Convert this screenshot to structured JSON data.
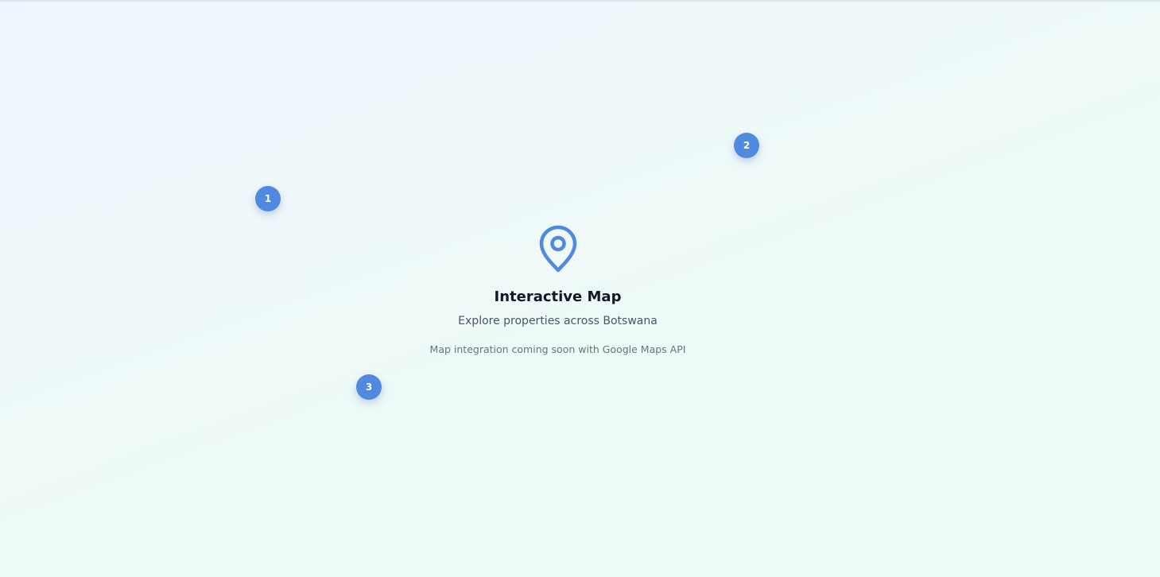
{
  "map": {
    "title": "Interactive Map",
    "subtitle": "Explore properties across Botswana",
    "note": "Map integration coming soon with Google Maps API",
    "icon": "map-pin-icon",
    "accent_color": "#4f8ae0",
    "markers": [
      {
        "label": "1"
      },
      {
        "label": "2"
      },
      {
        "label": "3"
      }
    ]
  }
}
